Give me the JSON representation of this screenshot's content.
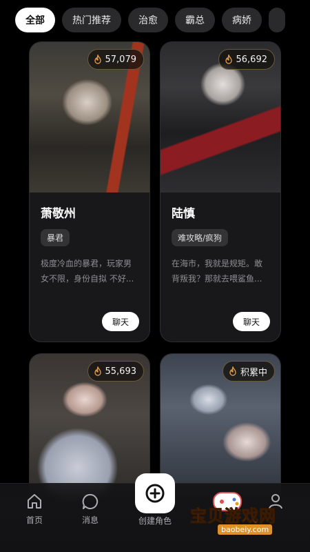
{
  "tabs": [
    {
      "label": "全部",
      "active": true
    },
    {
      "label": "热门推荐",
      "active": false
    },
    {
      "label": "治愈",
      "active": false
    },
    {
      "label": "霸总",
      "active": false
    },
    {
      "label": "病娇",
      "active": false
    }
  ],
  "cards": [
    {
      "badge": "57,079",
      "name": "萧敬州",
      "tag": "暴君",
      "desc": "极度冷血的暴君，玩家男女不限，身份自拟 不好...",
      "chat": "聊天"
    },
    {
      "badge": "56,692",
      "name": "陆慎",
      "tag": "难攻略/疯狗",
      "desc": "在海市，我就是规矩。敢背叛我？那就去喂鲨鱼...",
      "chat": "聊天"
    },
    {
      "badge": "55,693"
    },
    {
      "badge": "积累中"
    }
  ],
  "nav": {
    "home": "首页",
    "messages": "消息",
    "create": "创建角色"
  },
  "watermark": {
    "text": "宝贝游戏网",
    "url": "baobeiy.com"
  },
  "colors": {
    "background": "#000000",
    "card": "#18181a",
    "active_tab": "#ffffff",
    "badge_border": "#6b5a3c"
  }
}
